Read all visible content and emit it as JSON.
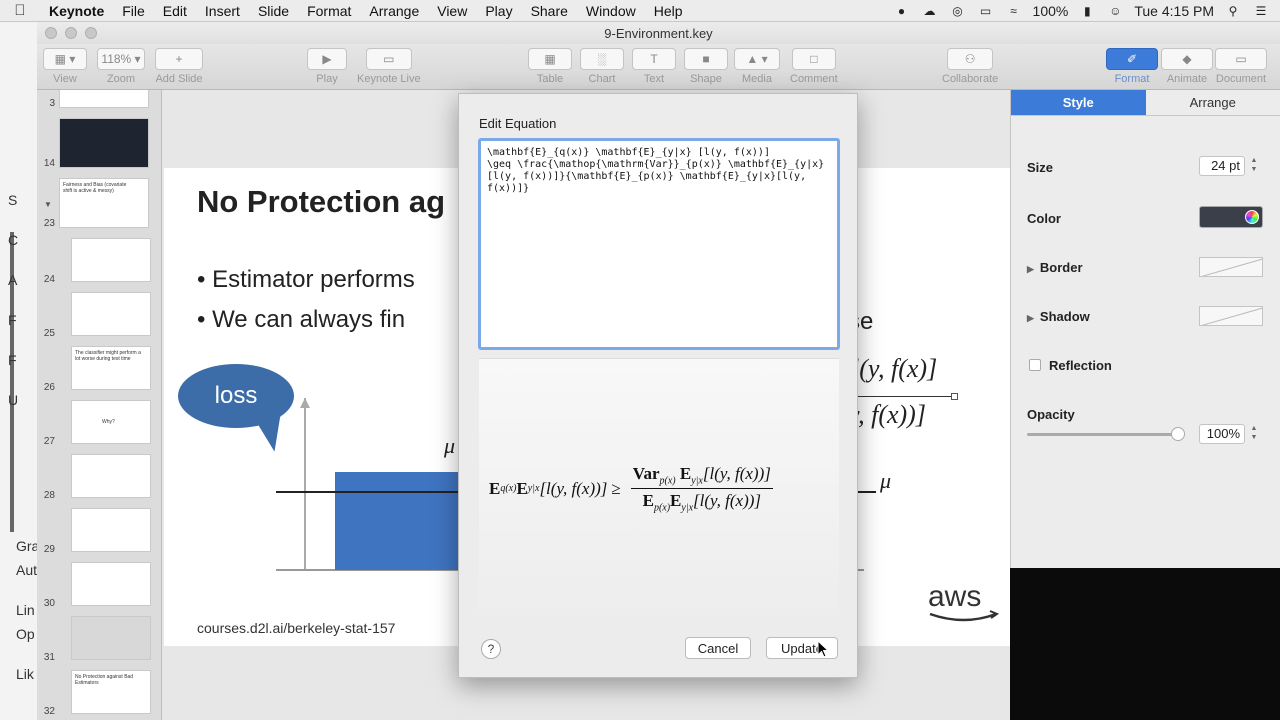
{
  "menubar": {
    "app": "Keynote",
    "menus": [
      "File",
      "Edit",
      "Insert",
      "Slide",
      "Format",
      "Arrange",
      "View",
      "Play",
      "Share",
      "Window",
      "Help"
    ],
    "battery": "100%",
    "clock": "Tue 4:15 PM"
  },
  "window": {
    "title": "9-Environment.key"
  },
  "toolbar": {
    "view": "View",
    "zoom_value": "118%",
    "zoom": "Zoom",
    "add_slide": "Add Slide",
    "play": "Play",
    "keynote_live": "Keynote Live",
    "table": "Table",
    "chart": "Chart",
    "text": "Text",
    "shape": "Shape",
    "media": "Media",
    "comment": "Comment",
    "collaborate": "Collaborate",
    "format": "Format",
    "animate": "Animate",
    "document": "Document"
  },
  "navigator": {
    "slides": [
      {
        "num": "3"
      },
      {
        "num": "14"
      },
      {
        "num": "23",
        "text": "Fairness and Bias (covariate shift is active & messy)"
      },
      {
        "num": "24"
      },
      {
        "num": "25"
      },
      {
        "num": "26",
        "text": "The classifier might perform a lot worse during test time"
      },
      {
        "num": "27",
        "text": "Why?"
      },
      {
        "num": "28"
      },
      {
        "num": "29"
      },
      {
        "num": "30"
      },
      {
        "num": "31"
      },
      {
        "num": "32",
        "text": "No Protection against Bad Estimators"
      }
    ]
  },
  "slide": {
    "title": "No Protection ag",
    "bullet1": "Estimator performs",
    "bullet2": "We can always fin",
    "bullet2_end": "rse",
    "bubble": "loss",
    "mu": "μ",
    "frag1": "l(y, f(x)]",
    "frag2": "y, f(x))]",
    "url": "courses.d2l.ai/berkeley-stat-157",
    "logo": "aws"
  },
  "equation_dialog": {
    "label": "Edit Equation",
    "latex": "\\mathbf{E}_{q(x)} \\mathbf{E}_{y|x} [l(y, f(x))]\n\\geq \\frac{\\mathop{\\mathrm{Var}}_{p(x)} \\mathbf{E}_{y|x}[l(y, f(x))]}{\\mathbf{E}_{p(x)} \\mathbf{E}_{y|x}[l(y, f(x))]}",
    "preview": {
      "lhs_E1": "E",
      "lhs_sub1": "q(x)",
      "lhs_E2": "E",
      "lhs_sub2": "y|x",
      "lhs_arg": "[l(y, f(x))]",
      "geq": "≥",
      "num_var": "Var",
      "num_sub": "p(x)",
      "num_E": "E",
      "num_sub2": "y|x",
      "num_arg": "[l(y, f(x))]",
      "den_E1": "E",
      "den_sub1": "p(x)",
      "den_E2": "E",
      "den_sub2": "y|x",
      "den_arg": "[l(y, f(x))]"
    },
    "help": "?",
    "cancel": "Cancel",
    "update": "Update"
  },
  "inspector": {
    "tab_style": "Style",
    "tab_arrange": "Arrange",
    "size_label": "Size",
    "size_value": "24 pt",
    "color_label": "Color",
    "border_label": "Border",
    "shadow_label": "Shadow",
    "reflection_label": "Reflection",
    "opacity_label": "Opacity",
    "opacity_value": "100%",
    "opacity_level": 1.0,
    "color_value": "#3a3f49"
  },
  "background_window": {
    "fragments": [
      "S",
      "C",
      "A",
      "F",
      "F",
      "U",
      "Gra",
      "Aut",
      "Lin",
      "Op",
      "Lik"
    ]
  }
}
